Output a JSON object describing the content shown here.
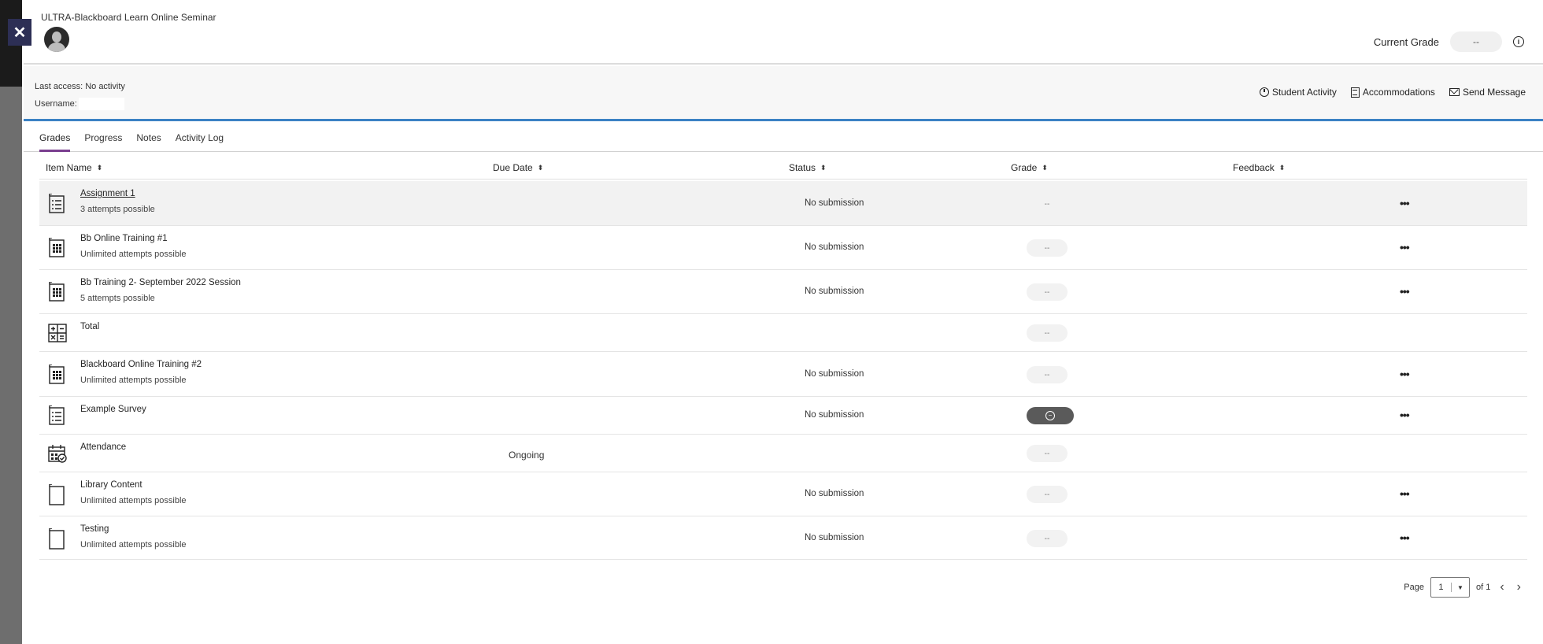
{
  "course": {
    "title": "ULTRA-Blackboard Learn Online Seminar"
  },
  "header": {
    "current_grade_label": "Current Grade",
    "current_grade_value": "--"
  },
  "info": {
    "last_access": "Last access: No activity",
    "username_label": "Username:",
    "actions": [
      "Student Activity",
      "Accommodations",
      "Send Message"
    ]
  },
  "tabs": [
    "Grades",
    "Progress",
    "Notes",
    "Activity Log"
  ],
  "columns": [
    "Item Name",
    "Due Date",
    "Status",
    "Grade",
    "Feedback"
  ],
  "rows": [
    {
      "icon": "assignment-icon",
      "name": "Assignment 1",
      "sub": "3 attempts possible",
      "due": "",
      "status": "No submission",
      "grade": "--",
      "more": "•••"
    },
    {
      "icon": "test-icon",
      "name": "Bb Online Training #1",
      "sub": "Unlimited attempts possible",
      "due": "",
      "status": "No submission",
      "grade": "--",
      "more": "•••"
    },
    {
      "icon": "test-icon",
      "name": "Bb Training 2- September 2022 Session",
      "sub": "5 attempts possible",
      "due": "",
      "status": "No submission",
      "grade": "--",
      "more": "•••"
    },
    {
      "icon": "calculation-icon",
      "name": "Total",
      "sub": "",
      "due": "",
      "status": "",
      "grade": "--",
      "more": ""
    },
    {
      "icon": "test-icon",
      "name": "Blackboard Online Training #2",
      "sub": "Unlimited attempts possible",
      "due": "",
      "status": "No submission",
      "grade": "--",
      "more": "•••"
    },
    {
      "icon": "survey-icon",
      "name": "Example Survey",
      "sub": "",
      "due": "",
      "status": "No submission",
      "grade": "",
      "more": "•••"
    },
    {
      "icon": "attendance-icon",
      "name": "Attendance",
      "sub": "",
      "due": "Ongoing",
      "status": "",
      "grade": "--",
      "more": ""
    },
    {
      "icon": "document-icon",
      "name": "Library Content",
      "sub": "Unlimited attempts possible",
      "due": "",
      "status": "No submission",
      "grade": "--",
      "more": "•••"
    },
    {
      "icon": "document-icon",
      "name": "Testing",
      "sub": "Unlimited attempts possible",
      "due": "",
      "status": "No submission",
      "grade": "--",
      "more": "•••"
    }
  ],
  "pager": {
    "label": "Page",
    "current": "1",
    "of": "of 1"
  }
}
